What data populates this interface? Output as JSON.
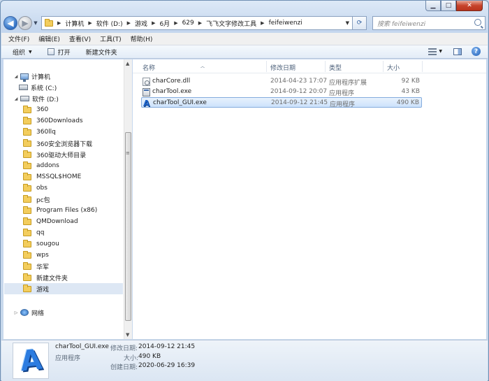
{
  "address": {
    "crumbs": [
      "计算机",
      "软件 (D:)",
      "游戏",
      "6月",
      "629",
      "飞飞文字修改工具",
      "feifeiwenzi"
    ]
  },
  "search": {
    "placeholder": "搜索 feifeiwenzi"
  },
  "menu": [
    "文件(F)",
    "编辑(E)",
    "查看(V)",
    "工具(T)",
    "帮助(H)"
  ],
  "toolbar": {
    "organize": "组织",
    "open": "打开",
    "new_folder": "新建文件夹"
  },
  "nav": {
    "computer": "计算机",
    "drive_c": "系统 (C:)",
    "drive_d": "软件 (D:)",
    "folders": [
      "360",
      "360Downloads",
      "360llq",
      "360安全浏览器下载",
      "360驱动大师目录",
      "addons",
      "MSSQL$HOME",
      "obs",
      "pc包",
      "Program Files (x86)",
      "QMDownload",
      "qq",
      "sougou",
      "wps",
      "华军",
      "新建文件夹",
      "游戏"
    ],
    "selected": "游戏",
    "network": "网络"
  },
  "columns": {
    "name": "名称",
    "modified": "修改日期",
    "type": "类型",
    "size": "大小"
  },
  "files": [
    {
      "name": "charCore.dll",
      "modified": "2014-04-23 17:07",
      "type": "应用程序扩展",
      "size": "92 KB",
      "icon": "dll-icon"
    },
    {
      "name": "charTool.exe",
      "modified": "2014-09-12 20:07",
      "type": "应用程序",
      "size": "43 KB",
      "icon": "exe-icon"
    },
    {
      "name": "charTool_GUI.exe",
      "modified": "2014-09-12 21:45",
      "type": "应用程序",
      "size": "490 KB",
      "icon": "app-a-icon"
    }
  ],
  "selected_file": "charTool_GUI.exe",
  "details": {
    "name": "charTool_GUI.exe",
    "type": "应用程序",
    "modified_label": "修改日期:",
    "modified": "2014-09-12 21:45",
    "size_label": "大小:",
    "size": "490 KB",
    "created_label": "创建日期:",
    "created": "2020-06-29 16:39"
  }
}
